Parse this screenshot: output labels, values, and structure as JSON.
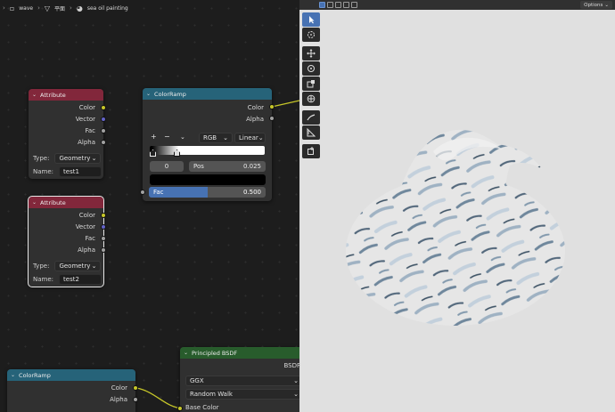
{
  "breadcrumb": {
    "object": "wave",
    "mesh": "平面",
    "material": "sea oil painting"
  },
  "nodes": {
    "attribute1": {
      "title": "Attribute",
      "outputs": [
        "Color",
        "Vector",
        "Fac",
        "Alpha"
      ],
      "type_label": "Type:",
      "type_value": "Geometry",
      "name_label": "Name:",
      "name_value": "test1"
    },
    "attribute2": {
      "title": "Attribute",
      "outputs": [
        "Color",
        "Vector",
        "Fac",
        "Alpha"
      ],
      "type_label": "Type:",
      "type_value": "Geometry",
      "name_label": "Name:",
      "name_value": "test2"
    },
    "colorramp1": {
      "title": "ColorRamp",
      "outputs": [
        "Color",
        "Alpha"
      ],
      "add": "+",
      "remove": "−",
      "color_mode": "RGB",
      "interpolation": "Linear",
      "stop_index": "0",
      "pos_label": "Pos",
      "pos_value": "0.025",
      "fac_label": "Fac",
      "fac_value": "0.500",
      "fac_fraction": 0.5,
      "stop_color": "#000000"
    },
    "colorramp2": {
      "title": "ColorRamp",
      "outputs": [
        "Color",
        "Alpha"
      ]
    },
    "bsdf": {
      "title": "Principled BSDF",
      "output": "BSDF",
      "distribution": "GGX",
      "subsurface_method": "Random Walk",
      "input_base_color": "Base Color"
    }
  },
  "viewport": {
    "options_label": "Options"
  },
  "colors": {
    "attribute_header": "#82273b",
    "colorramp_header": "#266379",
    "bsdf_header": "#285c2c",
    "socket_color": "#c7c729",
    "socket_vector": "#6363c7",
    "socket_float": "#a1a1a1",
    "accent": "#4772b3",
    "viewport_background": "#e0e0e0"
  },
  "icons": {
    "breadcrumb": [
      "object-icon",
      "mesh-icon",
      "material-icon"
    ],
    "toolbar": [
      "select-icon",
      "cursor-icon",
      "move-icon",
      "rotate-icon",
      "scale-icon",
      "transform-icon",
      "annotate-icon",
      "measure-icon",
      "add-cube-icon"
    ]
  }
}
